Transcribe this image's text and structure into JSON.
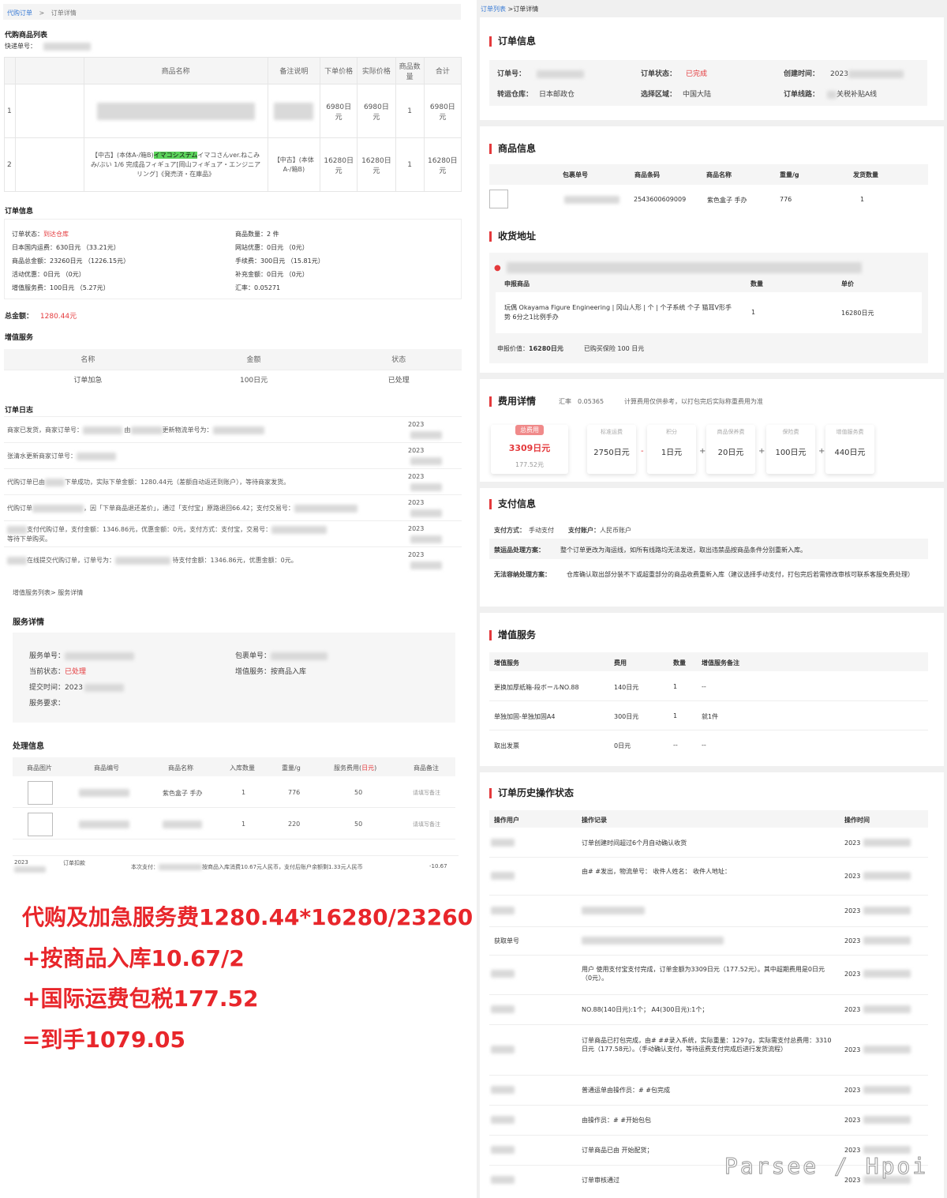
{
  "left_top": {
    "breadcrumb_link": "代购订单",
    "breadcrumb_sep": ">",
    "breadcrumb_current": "订单详情",
    "goods_list_title": "代购商品列表",
    "tracking_label": "快递单号：",
    "table_headers": [
      "商品名称",
      "备注说明",
      "下单价格",
      "实际价格",
      "商品数量",
      "合计"
    ],
    "rows": [
      {
        "idx": "1",
        "name": "",
        "note": "",
        "order_price": "6980日元",
        "actual_price": "6980日元",
        "qty": "1",
        "total": "6980日元"
      },
      {
        "idx": "2",
        "name_prefix": "【中古】(本体A-/箱B)",
        "name_highlight": "イマコシステム",
        "name_rest": "イマコさんver.ねこみみ/ぶい 1/6 完成品フィギュア[岡山フィギュア・エンジニアリング]《発売済・在庫品》",
        "note": "【中古】(本体A-/箱B)",
        "order_price": "16280日元",
        "actual_price": "16280日元",
        "qty": "1",
        "total": "16280日元"
      }
    ],
    "order_info_title": "订单信息",
    "order_info_left": [
      {
        "k": "订单状态：",
        "v": "到达仓库",
        "red": true
      },
      {
        "k": "日本国内运费：",
        "v": "630日元 （33.21元）"
      },
      {
        "k": "商品总金额：",
        "v": "23260日元 （1226.15元）"
      },
      {
        "k": "活动优惠：",
        "v": "0日元 （0元）"
      },
      {
        "k": "增值服务费：",
        "v": "100日元 （5.27元）"
      }
    ],
    "order_info_right": [
      {
        "k": "商品数量：",
        "v": "2 件"
      },
      {
        "k": "网站优惠：",
        "v": "0日元 （0元）"
      },
      {
        "k": "手续费：",
        "v": "300日元 （15.81元）"
      },
      {
        "k": "补充金额：",
        "v": "0日元 （0元）"
      },
      {
        "k": "汇率：",
        "v": "0.05271"
      }
    ],
    "total_label": "总金额：",
    "total_value": "1280.44元",
    "vas_title": "增值服务",
    "vas_headers": [
      "名称",
      "金额",
      "状态"
    ],
    "vas_row": [
      "订单加急",
      "100日元",
      "已处理"
    ],
    "log_title": "订单日志",
    "logs": [
      {
        "a": "商家已发货，商家订单号：",
        "b": "由",
        "c": "更新物流单号为：",
        "d": "",
        "time": "2023"
      },
      {
        "a": "张清水更新商家订单号：",
        "b": "",
        "c": "",
        "d": "",
        "time": "2023"
      },
      {
        "a": "代购订单已由",
        "b": "下单成功，实际下单金额：1280.44元（差额自动返还到账户），等待商家发货。",
        "c": "",
        "d": "",
        "time": "2023"
      },
      {
        "a": "代购订单",
        "b": "，因「下单商品退还差价」，通过「支付宝」原路退回66.42；支付交易号：",
        "c": "",
        "d": "",
        "time": "2023"
      },
      {
        "a": "支付代购订单，支付金额：1346.86元，优惠金额：0元，支付方式：支付宝，交易号：",
        "b": "等待下单购买。",
        "c": "",
        "d": "",
        "time": "2023"
      },
      {
        "a": "在线提交代购订单，订单号为：",
        "b": "待支付金额：1346.86元，优惠金额：0元。",
        "c": "",
        "d": "",
        "time": "2023"
      }
    ]
  },
  "left_mid": {
    "breadcrumb": "增值服务列表> 服务详情",
    "service_title": "服务详情",
    "service_no_label": "服务单号：",
    "package_no_label": "包裹单号：",
    "status_label": "当前状态：",
    "status_value": "已处理",
    "vas_label": "增值服务：",
    "vas_value": "按商品入库",
    "submit_label": "提交时间：",
    "submit_value": "2023",
    "request_label": "服务要求：",
    "process_title": "处理信息",
    "proc_headers": [
      "商品图片",
      "商品编号",
      "商品名称",
      "入库数量",
      "重量/g",
      "服务费用(日元)",
      "商品备注"
    ],
    "proc_rows": [
      {
        "name": "紫色盒子 手办",
        "qty": "1",
        "weight": "776",
        "fee": "50",
        "remark": "请填写备注"
      },
      {
        "name": "",
        "qty": "1",
        "weight": "220",
        "fee": "50",
        "remark": "请填写备注"
      }
    ],
    "bottom_time": "2023",
    "bottom_type": "订单扣款",
    "bottom_desc_a": "本次支付：",
    "bottom_desc_b": "按商品入库消费10.67元人民币，支付后账户余额剩1.33元人民币",
    "bottom_amount": "-10.67"
  },
  "calc_lines": [
    "代购及加急服务费1280.44*16280/23260",
    "+按商品入库10.67/2",
    "+国际运费包税177.52",
    "=到手1079.05"
  ],
  "right": {
    "breadcrumb_link": "订单列表",
    "breadcrumb_current": " >订单详情",
    "order_info_title": "订单信息",
    "order_no_label": "订单号：",
    "order_status_label": "订单状态：",
    "order_status_value": "已完成",
    "created_label": "创建时间：",
    "created_value": "2023",
    "warehouse_label": "转运仓库：",
    "warehouse_value": "日本邮政仓",
    "region_label": "选择区域：",
    "region_value": "中国大陆",
    "route_label": "订单线路：",
    "route_value": "关税补贴A线",
    "goods_title": "商品信息",
    "goods_headers": [
      "包裹单号",
      "商品条码",
      "商品名称",
      "重量/g",
      "发货数量"
    ],
    "goods_row": {
      "barcode": "2543600609009",
      "name": "紫色盒子 手办",
      "weight": "776",
      "qty": "1"
    },
    "address_title": "收货地址",
    "declare_headers": [
      "申报商品",
      "数量",
      "单价"
    ],
    "declare_row": {
      "name": "玩偶 Okayama Figure Engineering | 冈山人形 | 个 | 个子系统 个子 猫耳V形手势 6分之1比例手办",
      "qty": "1",
      "price": "16280日元"
    },
    "declare_value_label": "申报价值：",
    "declare_value": "16280日元",
    "insurance_text": "已购买保险 100 日元",
    "fee_title": "费用详情",
    "rate_label": "汇率",
    "rate_value": "0.05365",
    "fee_note": "计算费用仅供参考，以打包完后实际称重费用为准",
    "total_fee_label": "总费用",
    "total_fee_value": "3309日元",
    "total_fee_rmb": "177.52元",
    "fee_items": [
      {
        "label": "标准运费",
        "value": "2750日元",
        "op": "-",
        "red": false
      },
      {
        "label": "积分",
        "value": "1日元",
        "op": "+",
        "red": true
      },
      {
        "label": "商品保养费",
        "value": "20日元",
        "op": "+",
        "red": false
      },
      {
        "label": "保险费",
        "value": "100日元",
        "op": "+",
        "red": false
      },
      {
        "label": "增值服务费",
        "value": "440日元",
        "op": "",
        "red": false
      }
    ],
    "pay_title": "支付信息",
    "pay_method_label": "支付方式：",
    "pay_method_value": "手动支付",
    "pay_account_label": "支付账户：",
    "pay_account_value": "人民币账户",
    "contraband_label": "禁运品处理方案：",
    "contraband_value": "整个订单更改为海运线，如所有线路均无法发送，取出违禁品按商品条件分别重新入库。",
    "unfit_label": "无法容纳处理方案：",
    "unfit_value": "仓库确认取出部分装不下或超重部分的商品收费重新入库（建议选择手动支付，打包完后若需修改审核可联系客服免费处理）",
    "vas_title": "增值服务",
    "vas_headers": [
      "增值服务",
      "费用",
      "数量",
      "增值服务备注"
    ],
    "vas_rows": [
      {
        "name": "更换加厚纸箱-段ボールNO.88",
        "fee": "140日元",
        "qty": "1",
        "remark": "--"
      },
      {
        "name": "单独加固-单独加固A4",
        "fee": "300日元",
        "qty": "1",
        "remark": "就1件"
      },
      {
        "name": "取出发票",
        "fee": "0日元",
        "qty": "--",
        "remark": "--"
      }
    ],
    "history_title": "订单历史操作状态",
    "history_headers": [
      "操作用户",
      "操作记录",
      "操作时间"
    ],
    "history_rows": [
      {
        "user": "",
        "record": "订单创建时间超过6个月自动确认收货",
        "time": "2023"
      },
      {
        "user": "",
        "record": "由#        #发出，物流单号：                      收件人姓名：          收件人地址：",
        "time": "2023"
      },
      {
        "user": "",
        "record": "",
        "time": "2023"
      },
      {
        "user": "获取单号",
        "record": "",
        "time": "2023"
      },
      {
        "user": "",
        "record": "用户        使用支付宝支付完成，订单金额为3309日元（177.52元）。其中超期费用是0日元（0元）。",
        "time": "2023"
      },
      {
        "user": "",
        "record": "NO.88(140日元):1个； A4(300日元):1个；",
        "time": "2023"
      },
      {
        "user": "",
        "record": "订单商品已打包完成，由#        ##录入系统，实际重量：1297g，实际需支付总费用：3310日元（177.58元）。（手动确认支付，等待运费支付完成后进行发货流程）",
        "time": "2023"
      },
      {
        "user": "",
        "record": "普通运单由操作员：#            #包完成",
        "time": "2023"
      },
      {
        "user": "",
        "record": "由操作员：#            #开始包包",
        "time": "2023"
      },
      {
        "user": "",
        "record": "订单商品已由            开始配货；",
        "time": "2023"
      },
      {
        "user": "",
        "record": "订单审核通过",
        "time": "2023"
      }
    ]
  },
  "watermark": "Parsee / Hpoi",
  "colors": {
    "accent": "#e4393c",
    "highlight": "#5bd35b",
    "calc_text": "#e8262b"
  }
}
